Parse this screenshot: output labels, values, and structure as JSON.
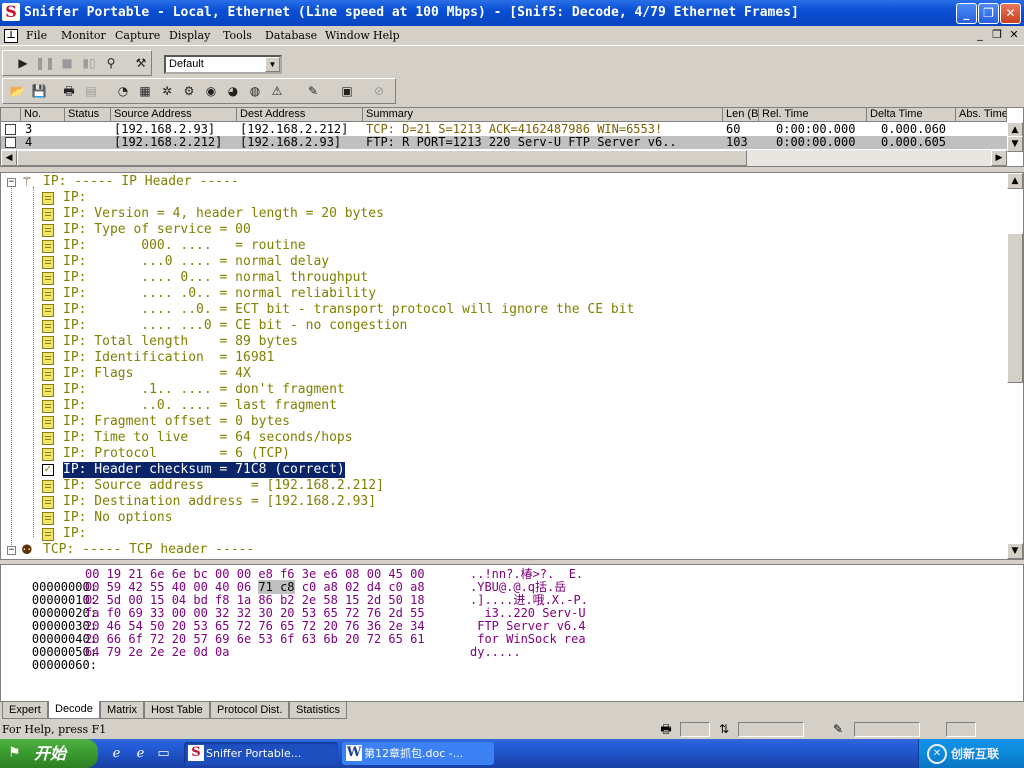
{
  "window": {
    "title": "Sniffer Portable - Local, Ethernet (Line speed at 100 Mbps) - [Snif5: Decode, 4/79 Ethernet Frames]",
    "minimize": "_",
    "maximize": "❐",
    "close": "✕"
  },
  "menu": {
    "items": [
      "File",
      "Monitor",
      "Capture",
      "Display",
      "Tools",
      "Database",
      "Window",
      "Help"
    ],
    "mdi_minimize": "_",
    "mdi_restore": "❐",
    "mdi_close": "✕"
  },
  "toolbar": {
    "profile_value": "Default"
  },
  "packet_list": {
    "columns": [
      "No.",
      "Status",
      "Source Address",
      "Dest Address",
      "Summary",
      "Len (B",
      "Rel. Time",
      "Delta Time",
      "Abs. Time"
    ],
    "rows": [
      {
        "no": "3",
        "status": "",
        "src": "[192.168.2.93]",
        "dst": "[192.168.2.212]",
        "summary": "TCP: D=21 S=1213     ACK=4162487986 WIN=6553!",
        "len": "60",
        "rel": "0:00:00.000",
        "delta": "0.000.060",
        "abs": ""
      },
      {
        "no": "4",
        "status": "",
        "src": "[192.168.2.212]",
        "dst": "[192.168.2.93]",
        "summary": "FTP: R PORT=1213   220 Serv-U FTP Server v6..",
        "len": "103",
        "rel": "0:00:00.000",
        "delta": "0.000.605",
        "abs": ""
      }
    ]
  },
  "decode": {
    "lines": [
      "IP: ----- IP Header -----",
      "IP:",
      "IP: Version = 4, header length = 20 bytes",
      "IP: Type of service = 00",
      "IP:       000. ....   = routine",
      "IP:       ...0 .... = normal delay",
      "IP:       .... 0... = normal throughput",
      "IP:       .... .0.. = normal reliability",
      "IP:       .... ..0. = ECT bit - transport protocol will ignore the CE bit",
      "IP:       .... ...0 = CE bit - no congestion",
      "IP: Total length    = 89 bytes",
      "IP: Identification  = 16981",
      "IP: Flags           = 4X",
      "IP:       .1.. .... = don't fragment",
      "IP:       ..0. .... = last fragment",
      "IP: Fragment offset = 0 bytes",
      "IP: Time to live    = 64 seconds/hops",
      "IP: Protocol        = 6 (TCP)",
      "IP: Header checksum = 71C8 (correct)",
      "IP: Source address      = [192.168.2.212]",
      "IP: Destination address = [192.168.2.93]",
      "IP: No options",
      "IP:",
      "TCP: ----- TCP header -----"
    ]
  },
  "hex": {
    "rows": [
      {
        "off": "00000000:",
        "bytes": "00 19 21 6e 6e bc 00 00 e8 f6 3e e6 08 00 45 00",
        "ascii": "..!nn?.椿>?.  E."
      },
      {
        "off": "00000010:",
        "bytes": "00 59 42 55 40 00 40 06 ",
        "hl": "71 c8",
        "bytes2": " c0 a8 02 d4 c0 a8",
        "ascii": ".YBU@.@.q括.岳"
      },
      {
        "off": "00000020:",
        "bytes": "02 5d 00 15 04 bd f8 1a 86 b2 2e 58 15 2d 50 18",
        "ascii": ".]....进.哦.X.-P."
      },
      {
        "off": "00000030:",
        "bytes": "fa f0 69 33 00 00 32 32 30 20 53 65 72 76 2d 55",
        "ascii": "  i3..220 Serv-U"
      },
      {
        "off": "00000040:",
        "bytes": "20 46 54 50 20 53 65 72 76 65 72 20 76 36 2e 34",
        "ascii": " FTP Server v6.4"
      },
      {
        "off": "00000050:",
        "bytes": "20 66 6f 72 20 57 69 6e 53 6f 63 6b 20 72 65 61",
        "ascii": " for WinSock rea"
      },
      {
        "off": "00000060:",
        "bytes": "64 79 2e 2e 2e 0d 0a",
        "ascii": "dy....."
      }
    ]
  },
  "tabs": [
    "Expert",
    "Decode",
    "Matrix",
    "Host Table",
    "Protocol Dist.",
    "Statistics"
  ],
  "status": {
    "help": "For Help, press F1"
  },
  "taskbar": {
    "start": "开始",
    "tasks": [
      "Sniffer Portable...",
      "第12章抓包.doc -..."
    ],
    "watermark": "创新互联"
  },
  "colors": {
    "titlebar": "#0a4fd4",
    "selection": "#0a246a",
    "decode_text": "#808000",
    "hex_text": "#800080"
  }
}
